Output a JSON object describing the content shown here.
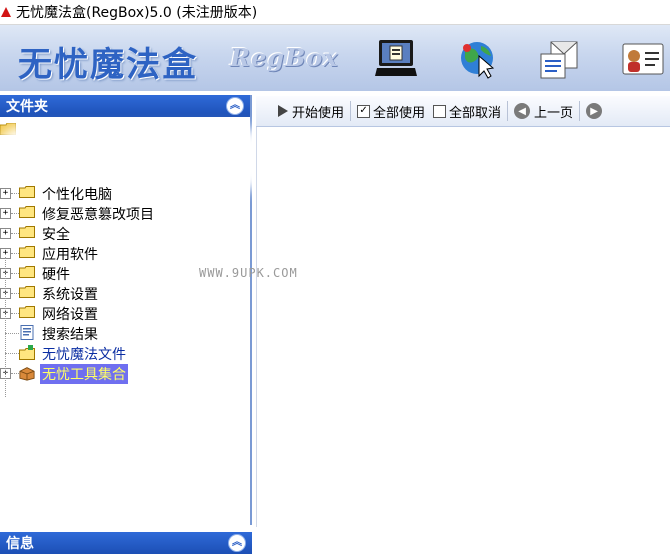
{
  "window": {
    "title": "无忧魔法盒(RegBox)5.0 (未注册版本)"
  },
  "banner": {
    "brand_cn": "无忧魔法盒",
    "brand_en": "RegBox",
    "tools": [
      {
        "icon": "monitor-icon"
      },
      {
        "icon": "globe-cursor-icon"
      },
      {
        "icon": "document-envelope-icon"
      },
      {
        "icon": "user-card-icon"
      }
    ]
  },
  "left_panel": {
    "header": "文件夹",
    "tree": [
      {
        "label": "个性化电脑",
        "icon": "folder-icon"
      },
      {
        "label": "修复恶意篡改项目",
        "icon": "folder-icon"
      },
      {
        "label": "安全",
        "icon": "folder-icon"
      },
      {
        "label": "应用软件",
        "icon": "folder-icon"
      },
      {
        "label": "硬件",
        "icon": "folder-icon"
      },
      {
        "label": "系统设置",
        "icon": "folder-icon"
      },
      {
        "label": "网络设置",
        "icon": "folder-icon"
      },
      {
        "label": "搜索结果",
        "icon": "search-doc-icon"
      },
      {
        "label": "无忧魔法文件",
        "icon": "magic-folder-icon"
      },
      {
        "label": "无忧工具集合",
        "icon": "toolbox-icon"
      }
    ]
  },
  "toolbar": {
    "start_use": "开始使用",
    "select_all": "全部使用",
    "cancel_all": "全部取消",
    "prev_page": "上一页"
  },
  "watermark": "WWW.9UPK.COM",
  "info_panel": {
    "header": "信息"
  },
  "colors": {
    "panel_header": "#1c4fb5",
    "banner": "#c8d6ee",
    "selected_bg": "#6f6ff0",
    "selected_text": "#ffff66"
  }
}
